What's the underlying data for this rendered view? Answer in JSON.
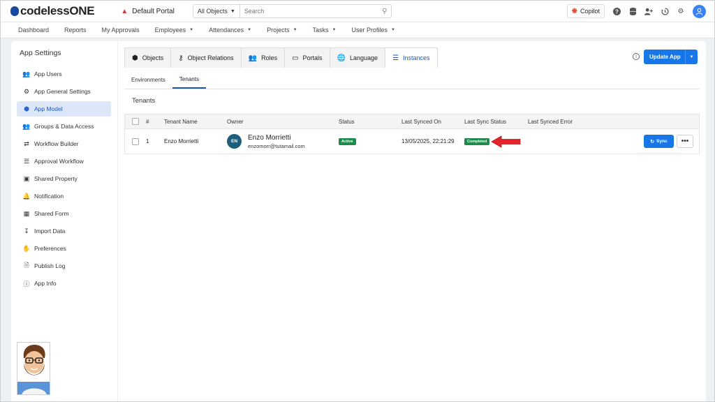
{
  "topbar": {
    "brand": "codelessONE",
    "portal": "Default Portal",
    "object_select": "All Objects",
    "search_placeholder": "Search",
    "copilot": "Copilot"
  },
  "nav": {
    "items": [
      {
        "label": "Dashboard",
        "dropdown": false
      },
      {
        "label": "Reports",
        "dropdown": false
      },
      {
        "label": "My Approvals",
        "dropdown": false
      },
      {
        "label": "Employees",
        "dropdown": true
      },
      {
        "label": "Attendances",
        "dropdown": true
      },
      {
        "label": "Projects",
        "dropdown": true
      },
      {
        "label": "Tasks",
        "dropdown": true
      },
      {
        "label": "User Profiles",
        "dropdown": true
      }
    ]
  },
  "sidebar": {
    "title": "App Settings",
    "items": [
      {
        "label": "App Users",
        "icon": "users-icon",
        "active": false
      },
      {
        "label": "App General Settings",
        "icon": "gear-icon",
        "active": false
      },
      {
        "label": "App Model",
        "icon": "cube-icon",
        "active": true
      },
      {
        "label": "Groups & Data Access",
        "icon": "group-icon",
        "active": false
      },
      {
        "label": "Workflow Builder",
        "icon": "workflow-icon",
        "active": false
      },
      {
        "label": "Approval Workflow",
        "icon": "checklist-icon",
        "active": false
      },
      {
        "label": "Shared Property",
        "icon": "inbox-icon",
        "active": false
      },
      {
        "label": "Notification",
        "icon": "bell-icon",
        "active": false
      },
      {
        "label": "Shared Form",
        "icon": "form-icon",
        "active": false
      },
      {
        "label": "Import Data",
        "icon": "import-icon",
        "active": false
      },
      {
        "label": "Preferences",
        "icon": "hand-icon",
        "active": false
      },
      {
        "label": "Publish Log",
        "icon": "file-icon",
        "active": false
      },
      {
        "label": "App Info",
        "icon": "info-icon",
        "active": false
      }
    ]
  },
  "tabs": [
    {
      "label": "Objects",
      "icon": "cube-icon",
      "active": false
    },
    {
      "label": "Object Relations",
      "icon": "relations-icon",
      "active": false
    },
    {
      "label": "Roles",
      "icon": "users-icon",
      "active": false
    },
    {
      "label": "Portals",
      "icon": "monitor-icon",
      "active": false
    },
    {
      "label": "Language",
      "icon": "globe-icon",
      "active": false
    },
    {
      "label": "Instances",
      "icon": "database-icon",
      "active": true
    }
  ],
  "update_button": "Update App",
  "subtabs": [
    {
      "label": "Environments",
      "active": false
    },
    {
      "label": "Tenants",
      "active": true
    }
  ],
  "section_title": "Tenants",
  "table": {
    "headers": [
      "#",
      "Tenant Name",
      "Owner",
      "Status",
      "Last Synced On",
      "Last Sync Status",
      "Last Synced Error"
    ],
    "rows": [
      {
        "num": "1",
        "tenant": "Enzo Morrietti",
        "owner_initials": "EN",
        "owner_name": "Enzo Morrietti",
        "owner_email": "enzomorr@tutamail.com",
        "status": "Active",
        "synced_on": "13/05/2025, 22:21:29",
        "sync_status": "Completed",
        "error": ""
      }
    ],
    "sync_label": "Sync",
    "more_label": "•••"
  },
  "colors": {
    "accent": "#1877e8",
    "active_bg": "#dde7f7",
    "badge_green": "#1e8a4c",
    "arrow_red": "#e5242b"
  }
}
